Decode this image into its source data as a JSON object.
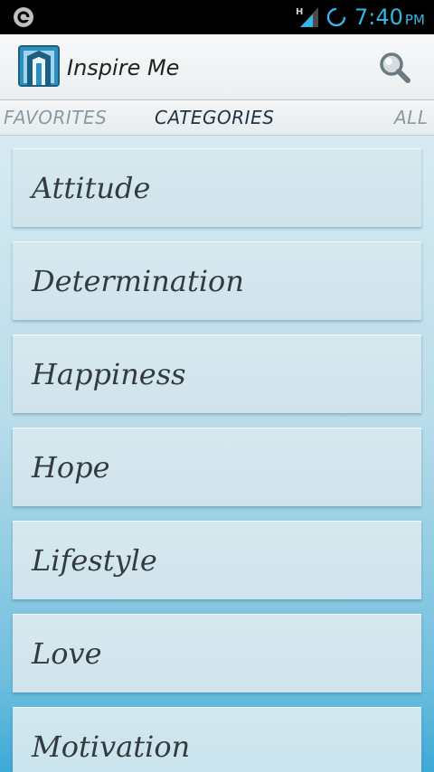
{
  "status_bar": {
    "time": "7:40",
    "ampm": "PM",
    "network_type": "H",
    "time_color": "#33b5e5",
    "icons": [
      "app-notification-icon",
      "signal-icon",
      "sync-icon"
    ]
  },
  "action_bar": {
    "title": "Inspire Me",
    "icons": [
      "app-logo-icon",
      "search-icon"
    ]
  },
  "tabs": [
    {
      "label": "FAVORITES",
      "selected": false
    },
    {
      "label": "CATEGORIES",
      "selected": true
    },
    {
      "label": "ALL",
      "selected": false
    }
  ],
  "categories": [
    {
      "label": "Attitude"
    },
    {
      "label": "Determination"
    },
    {
      "label": "Happiness"
    },
    {
      "label": "Hope"
    },
    {
      "label": "Lifestyle"
    },
    {
      "label": "Love"
    },
    {
      "label": "Motivation"
    }
  ],
  "colors": {
    "accent": "#33b5e5",
    "background_top": "#d8ebf2",
    "background_bottom": "#3ea9d6",
    "card": "#d2e6ee",
    "text": "#333b40"
  }
}
